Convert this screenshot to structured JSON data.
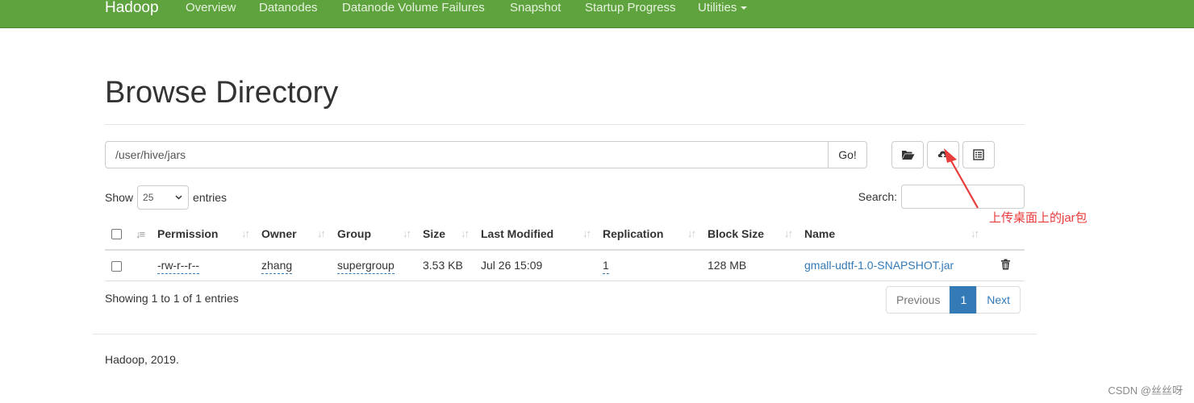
{
  "navbar": {
    "brand": "Hadoop",
    "items": [
      "Overview",
      "Datanodes",
      "Datanode Volume Failures",
      "Snapshot",
      "Startup Progress"
    ],
    "utilities": "Utilities",
    "bg_color": "#5fa33e"
  },
  "page": {
    "title": "Browse Directory"
  },
  "path": {
    "value": "/user/hive/jars",
    "go_label": "Go!"
  },
  "toolbar": {
    "icons": [
      "folder-open-icon",
      "cloud-upload-icon",
      "list-alt-icon"
    ]
  },
  "entries": {
    "show_label": "Show",
    "length_value": "25",
    "entries_label": "entries",
    "search_label": "Search:"
  },
  "table": {
    "columns": [
      "Permission",
      "Owner",
      "Group",
      "Size",
      "Last Modified",
      "Replication",
      "Block Size",
      "Name"
    ],
    "rows": [
      {
        "permission": "-rw-r--r--",
        "owner": "zhang",
        "group": "supergroup",
        "size": "3.53 KB",
        "last_modified": "Jul 26 15:09",
        "replication": "1",
        "block_size": "128 MB",
        "name": "gmall-udtf-1.0-SNAPSHOT.jar"
      }
    ]
  },
  "info": "Showing 1 to 1 of 1 entries",
  "pagination": {
    "previous": "Previous",
    "current": "1",
    "next": "Next"
  },
  "footer": "Hadoop, 2019.",
  "annotation": {
    "text": "上传桌面上的jar包",
    "color": "#e83b3b"
  },
  "watermark": "CSDN @丝丝呀"
}
